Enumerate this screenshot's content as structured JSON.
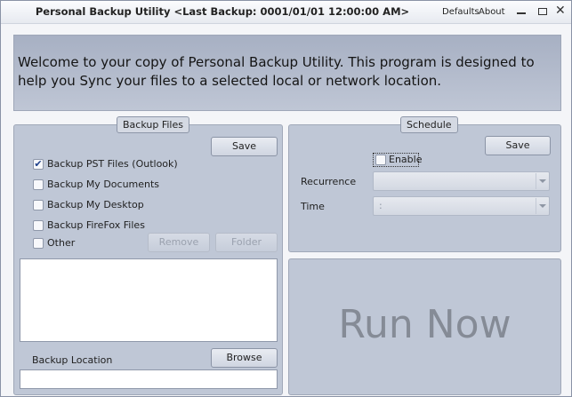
{
  "window": {
    "title": "Personal Backup Utility <Last Backup: 0001/01/01 12:00:00 AM>",
    "links": {
      "defaults": "Defaults",
      "about": "About"
    },
    "controls": {
      "minimize": "minimize-icon",
      "maximize": "maximize-icon",
      "close": "close-icon",
      "close_glyph": "✕"
    }
  },
  "welcome": {
    "text": "Welcome to your copy of Personal Backup Utility. This program is designed to help you Sync your files to a selected local or network location."
  },
  "backup_files": {
    "legend": "Backup Files",
    "save_label": "Save",
    "options": [
      {
        "label": "Backup PST Files (Outlook)",
        "checked": true
      },
      {
        "label": "Backup My Documents",
        "checked": false
      },
      {
        "label": "Backup My Desktop",
        "checked": false
      },
      {
        "label": "Backup FireFox Files",
        "checked": false
      },
      {
        "label": "Other",
        "checked": false
      }
    ],
    "remove_label": "Remove",
    "folder_label": "Folder",
    "location_label": "Backup Location",
    "browse_label": "Browse",
    "location_value": ""
  },
  "schedule": {
    "legend": "Schedule",
    "save_label": "Save",
    "enable_label": "Enable",
    "enable_checked": false,
    "recurrence_label": "Recurrence",
    "recurrence_value": "",
    "time_label": "Time",
    "time_value": ":"
  },
  "run_now": {
    "label": "Run Now"
  },
  "colors": {
    "panel": "#bfc7d6",
    "welcome": "#b3bbcc",
    "run_now_text": "#858b96"
  }
}
